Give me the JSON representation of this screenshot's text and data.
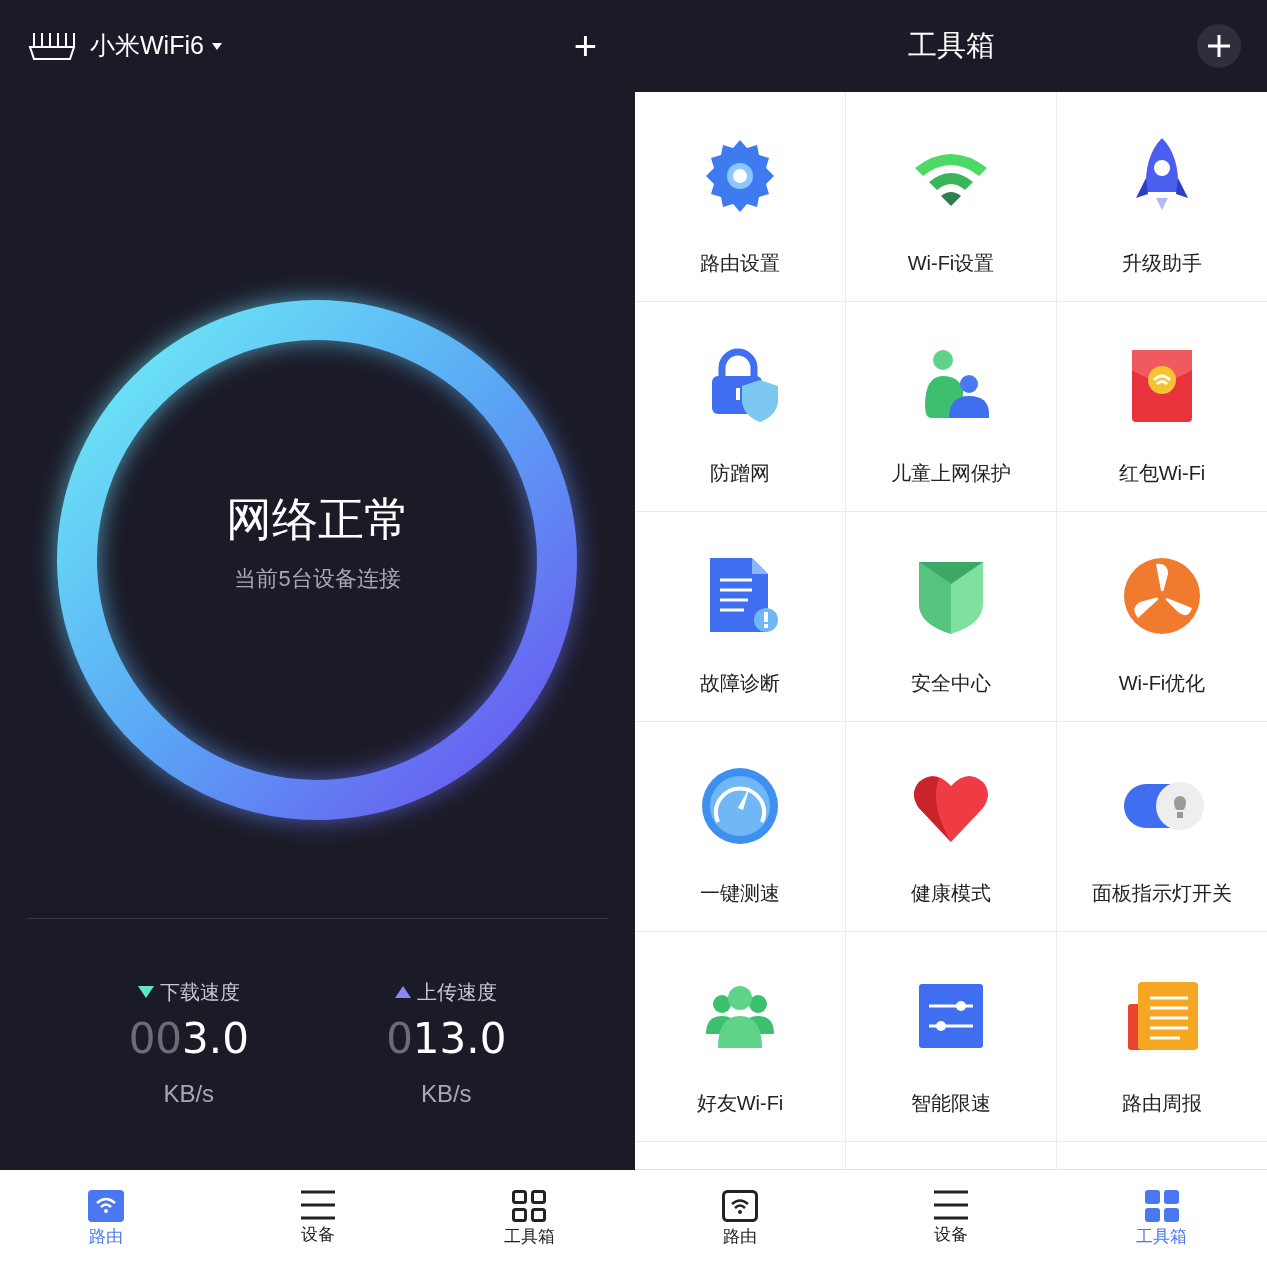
{
  "left": {
    "header": {
      "title": "小米WiFi6",
      "add": "+"
    },
    "status": {
      "title": "网络正常",
      "subtitle": "当前5台设备连接"
    },
    "speeds": [
      {
        "kind": "down",
        "label": "下载速度",
        "leading": "00",
        "value": "3.0",
        "unit": "KB/s"
      },
      {
        "kind": "up",
        "label": "上传速度",
        "leading": "0",
        "value": "13.0",
        "unit": "KB/s"
      }
    ],
    "nav": [
      {
        "label": "路由",
        "selected": true
      },
      {
        "label": "设备",
        "selected": false
      },
      {
        "label": "工具箱",
        "selected": false
      }
    ]
  },
  "right": {
    "header": {
      "title": "工具箱"
    },
    "tools": [
      {
        "label": "路由设置"
      },
      {
        "label": "Wi-Fi设置"
      },
      {
        "label": "升级助手"
      },
      {
        "label": "防蹭网"
      },
      {
        "label": "儿童上网保护"
      },
      {
        "label": "红包Wi-Fi"
      },
      {
        "label": "故障诊断"
      },
      {
        "label": "安全中心"
      },
      {
        "label": "Wi-Fi优化"
      },
      {
        "label": "一键测速"
      },
      {
        "label": "健康模式"
      },
      {
        "label": "面板指示灯开关"
      },
      {
        "label": "好友Wi-Fi"
      },
      {
        "label": "智能限速"
      },
      {
        "label": "路由周报"
      }
    ],
    "nav": [
      {
        "label": "路由",
        "selected": false
      },
      {
        "label": "设备",
        "selected": false
      },
      {
        "label": "工具箱",
        "selected": true
      }
    ]
  }
}
